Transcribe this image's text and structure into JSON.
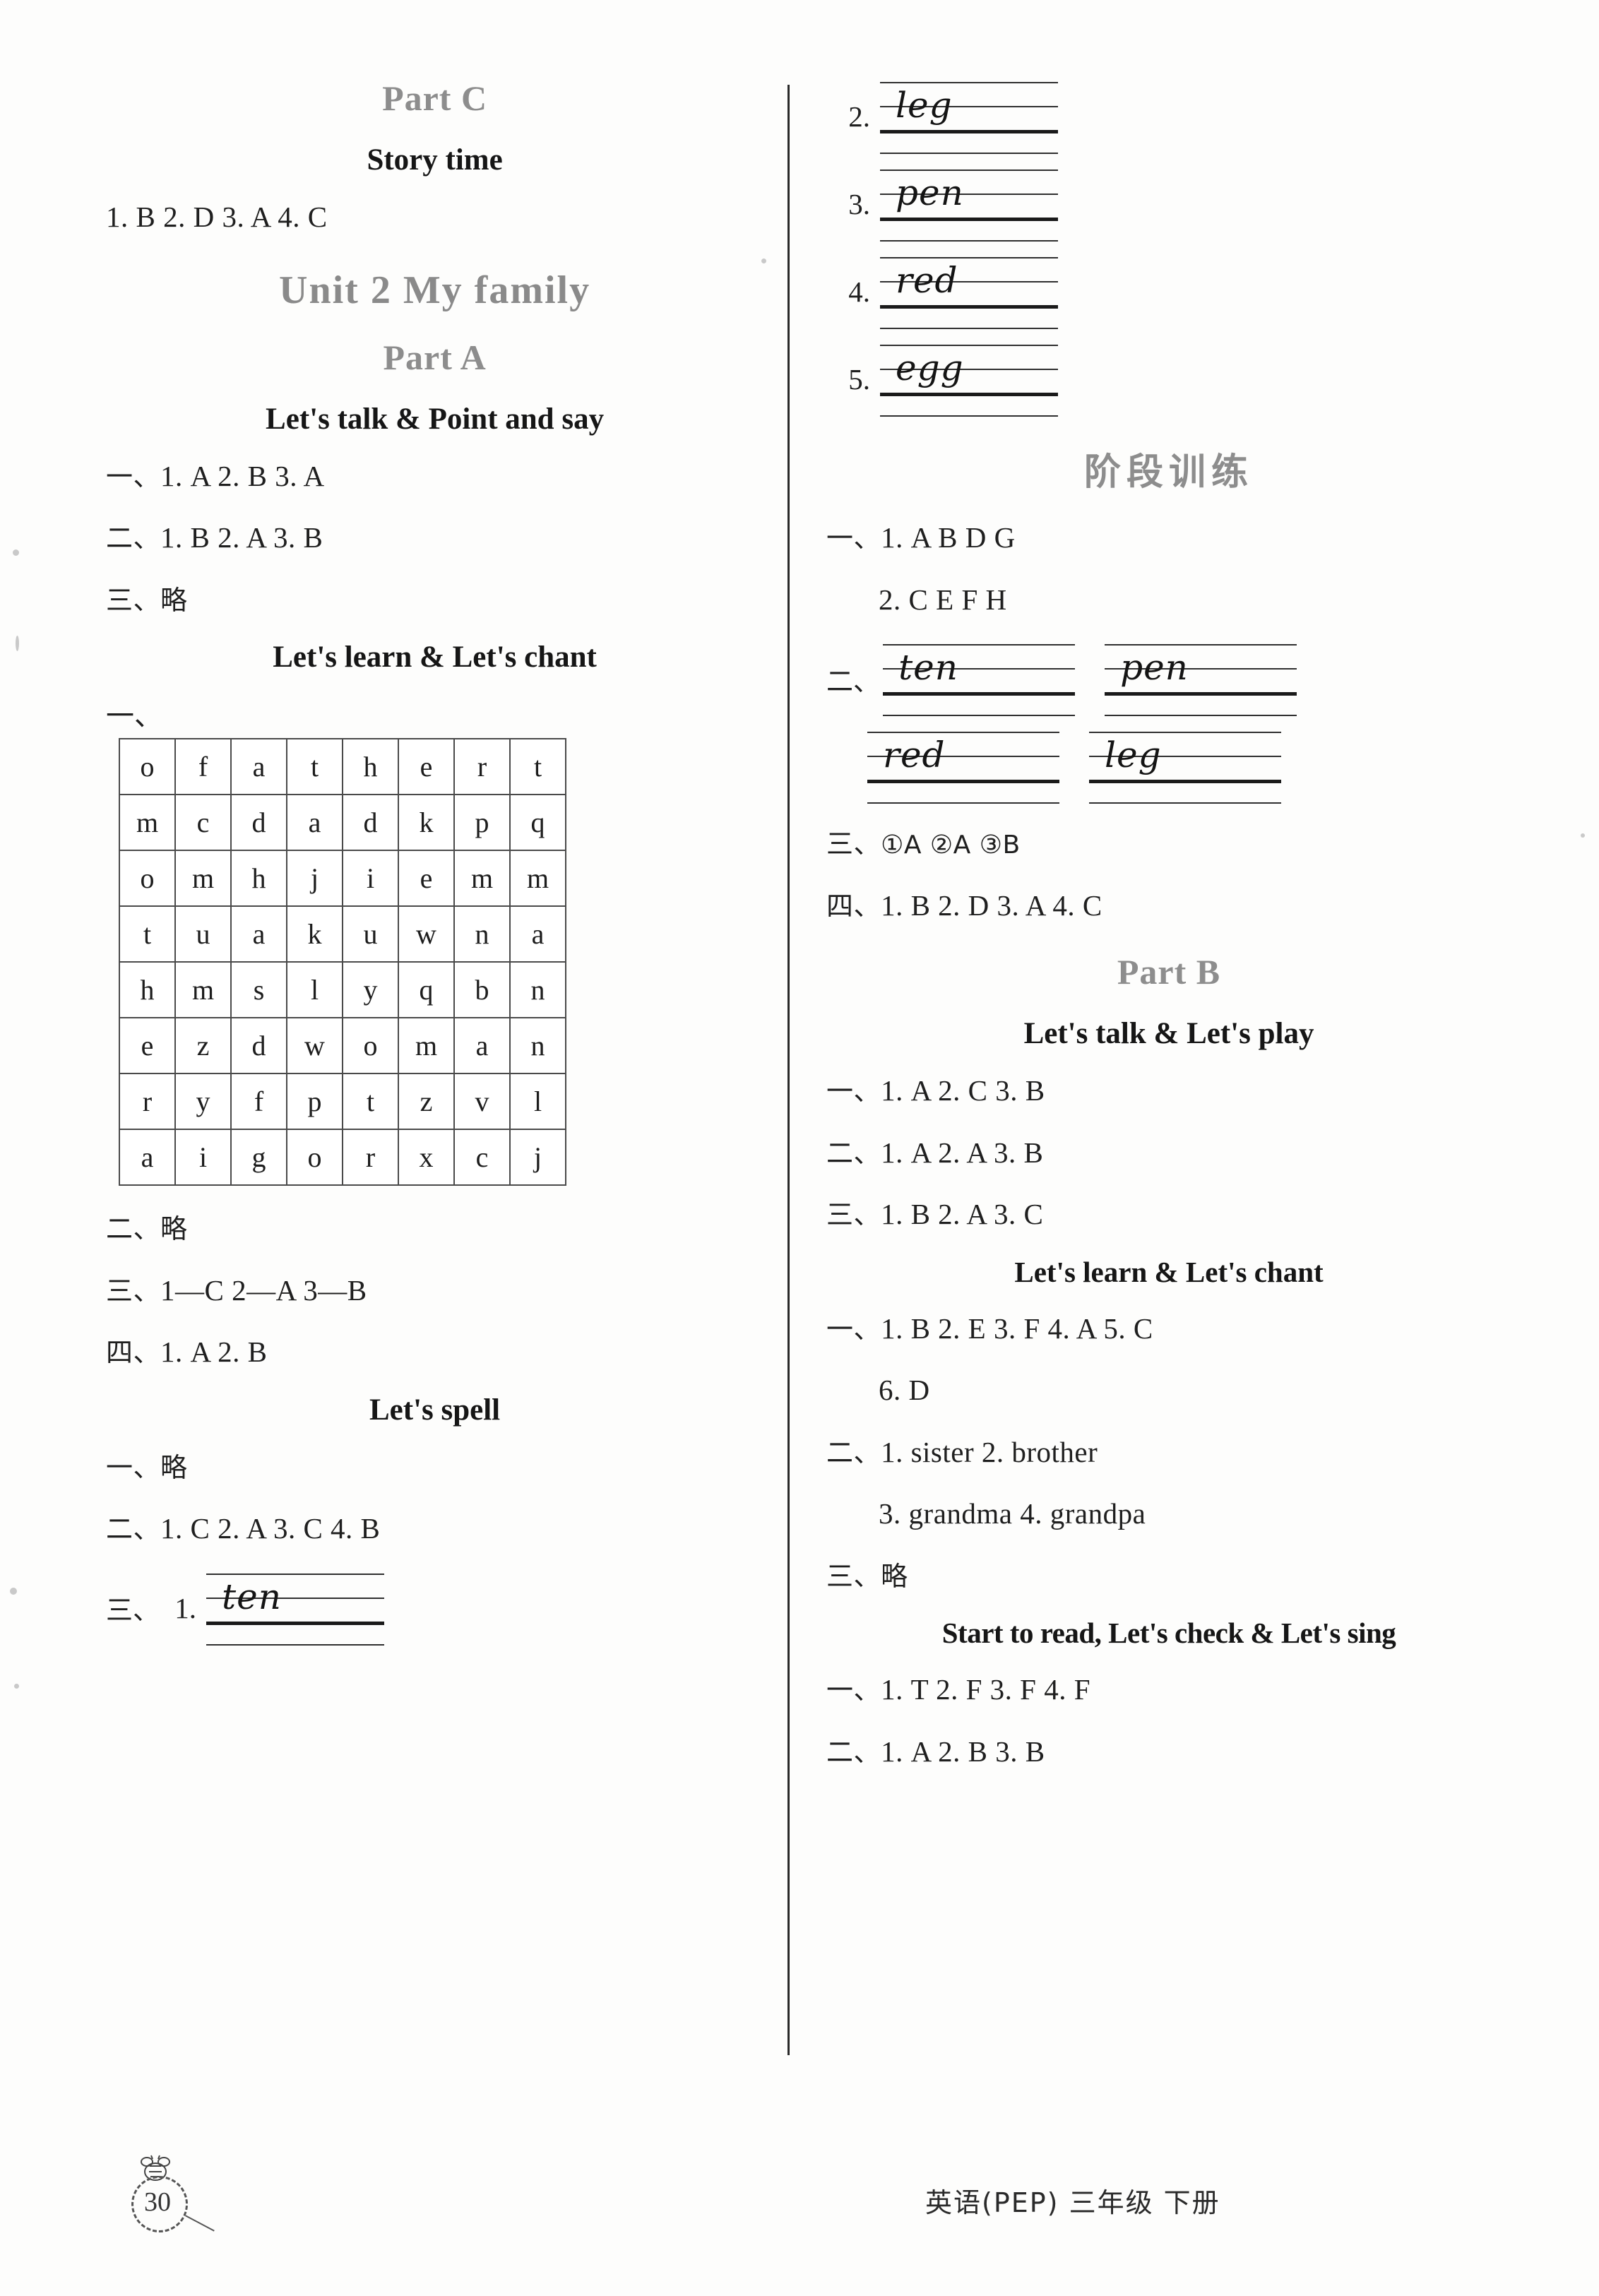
{
  "page": {
    "number": "30",
    "footer_text": "英语(PEP) 三年级 下册"
  },
  "left_column": {
    "part_c": {
      "heading": "Part C",
      "story_time_heading": "Story time",
      "answers": "1. B   2. D   3. A   4. C"
    },
    "unit_heading": "Unit 2   My family",
    "part_a": {
      "heading": "Part A",
      "talk_point_heading": "Let's talk & Point and say",
      "rows": [
        {
          "marker": "一、",
          "text": "1. A   2. B   3. A"
        },
        {
          "marker": "二、",
          "text": "1. B   2. A   3. B"
        },
        {
          "marker": "三、",
          "text": "略"
        }
      ],
      "learn_chant_heading": "Let's learn & Let's chant",
      "grid_marker": "一、",
      "word_grid": [
        [
          "o",
          "f",
          "a",
          "t",
          "h",
          "e",
          "r",
          "t"
        ],
        [
          "m",
          "c",
          "d",
          "a",
          "d",
          "k",
          "p",
          "q"
        ],
        [
          "o",
          "m",
          "h",
          "j",
          "i",
          "e",
          "m",
          "m"
        ],
        [
          "t",
          "u",
          "a",
          "k",
          "u",
          "w",
          "n",
          "a"
        ],
        [
          "h",
          "m",
          "s",
          "l",
          "y",
          "q",
          "b",
          "n"
        ],
        [
          "e",
          "z",
          "d",
          "w",
          "o",
          "m",
          "a",
          "n"
        ],
        [
          "r",
          "y",
          "f",
          "p",
          "t",
          "z",
          "v",
          "l"
        ],
        [
          "a",
          "i",
          "g",
          "o",
          "r",
          "x",
          "c",
          "j"
        ]
      ],
      "rows_after_grid": [
        {
          "marker": "二、",
          "text": "略"
        },
        {
          "marker": "三、",
          "text": "1—C   2—A   3—B"
        },
        {
          "marker": "四、",
          "text": "1. A   2. B"
        }
      ],
      "lets_spell_heading": "Let's spell",
      "spell_rows": [
        {
          "marker": "一、",
          "text": "略"
        },
        {
          "marker": "二、",
          "text": "1. C   2. A   3. C   4. B"
        }
      ],
      "spell_handwriting_marker": "三、",
      "spell_handwriting": [
        {
          "number": "1.",
          "word": "ten"
        }
      ]
    }
  },
  "right_column": {
    "handwriting_continued": [
      {
        "number": "2.",
        "word": "leg"
      },
      {
        "number": "3.",
        "word": "pen"
      },
      {
        "number": "4.",
        "word": "red"
      },
      {
        "number": "5.",
        "word": "egg"
      }
    ],
    "stage_training": {
      "heading": "阶段训练",
      "rows": [
        {
          "marker": "一、",
          "text": "1. A B D G"
        },
        {
          "marker": "",
          "text": "2. C E F H",
          "indent": true
        }
      ],
      "handwriting_marker": "二、",
      "handwriting_words": [
        "ten",
        "pen",
        "red",
        "leg"
      ],
      "rows_after": [
        {
          "marker": "三、",
          "text": "①A   ②A   ③B"
        },
        {
          "marker": "四、",
          "text": "1. B   2. D   3. A   4. C"
        }
      ]
    },
    "part_b": {
      "heading": "Part B",
      "talk_play_heading": "Let's talk & Let's play",
      "rows": [
        {
          "marker": "一、",
          "text": "1. A   2. C   3. B"
        },
        {
          "marker": "二、",
          "text": "1. A   2. A   3. B"
        },
        {
          "marker": "三、",
          "text": "1. B   2. A   3. C"
        }
      ],
      "learn_chant_heading": "Let's learn & Let's chant",
      "learn_rows": [
        {
          "marker": "一、",
          "text": "1. B   2. E   3. F   4. A   5. C"
        },
        {
          "marker": "",
          "text": "6. D",
          "indent": true
        },
        {
          "marker": "二、",
          "text": "1. sister   2. brother"
        },
        {
          "marker": "",
          "text": "3. grandma   4. grandpa",
          "indent": true
        },
        {
          "marker": "三、",
          "text": "略"
        }
      ],
      "start_read_heading": "Start to read, Let's check & Let's sing",
      "read_rows": [
        {
          "marker": "一、",
          "text": "1. T   2. F   3. F   4. F"
        },
        {
          "marker": "二、",
          "text": "1. A   2. B   3. B"
        }
      ]
    }
  }
}
